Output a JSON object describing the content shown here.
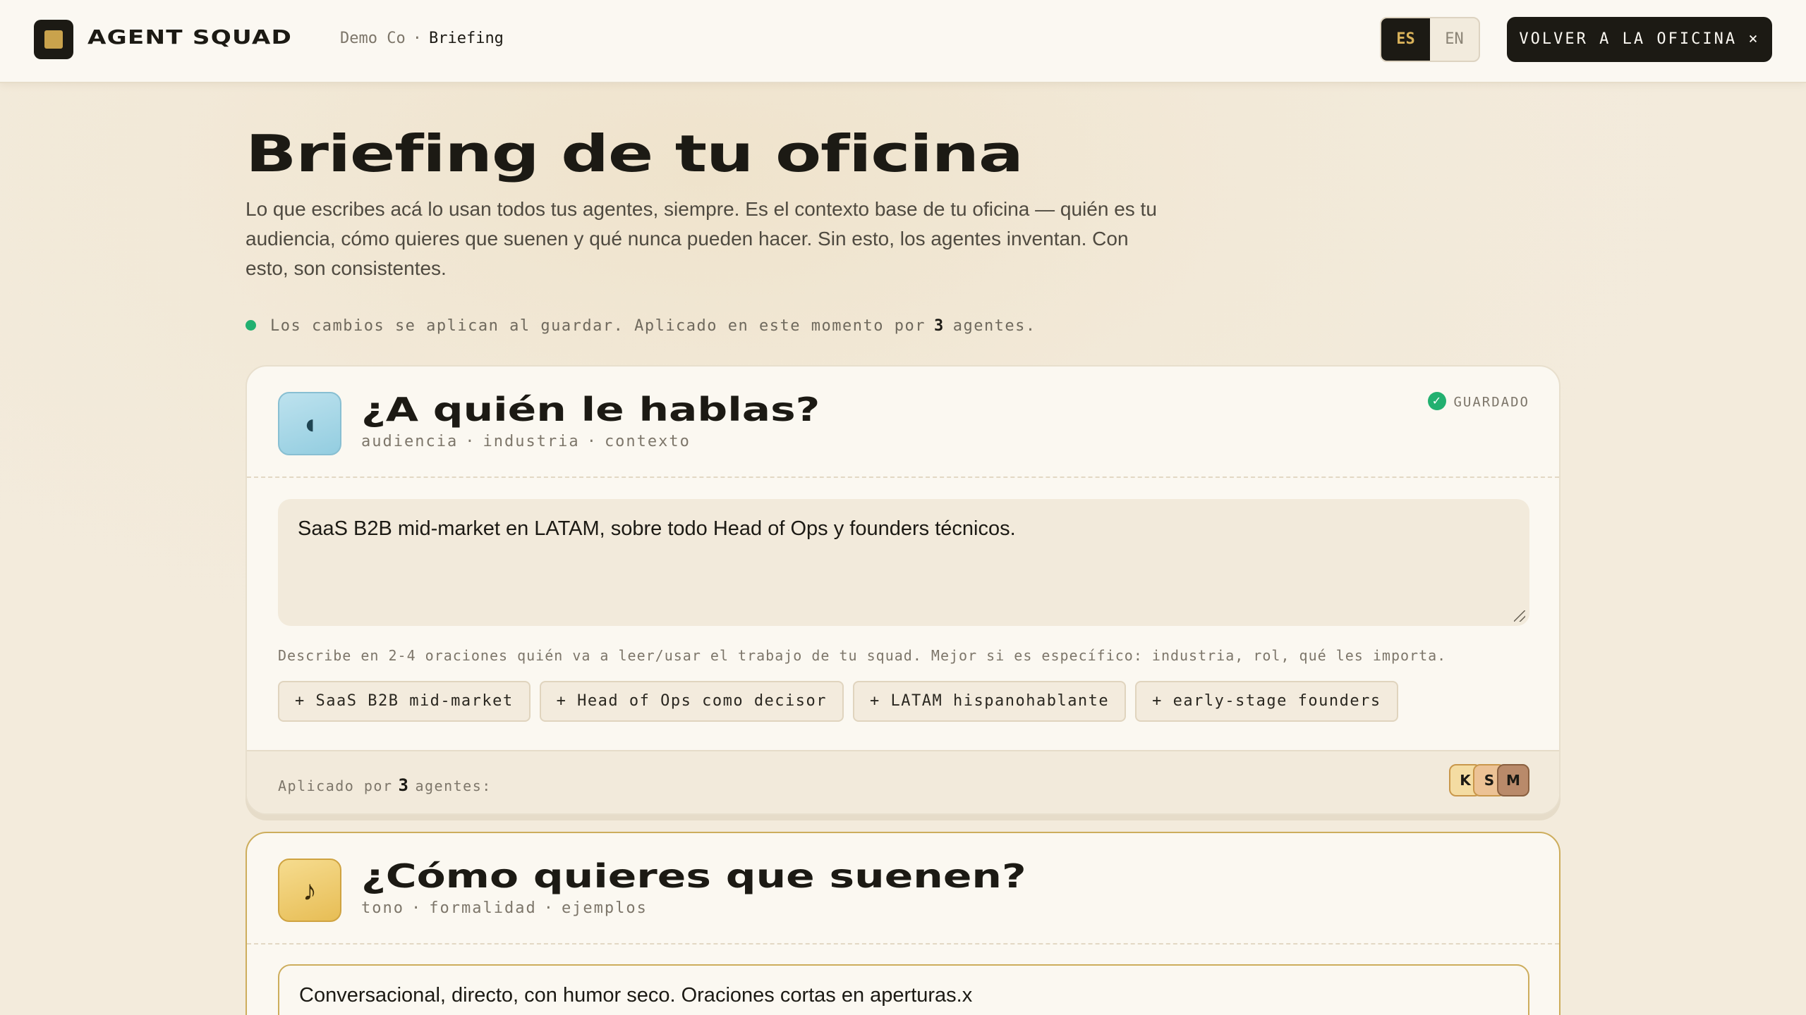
{
  "brand": "AGENT SQUAD",
  "breadcrumb": {
    "company": "Demo Co",
    "separator": "·",
    "current": "Briefing"
  },
  "lang": {
    "es": "ES",
    "en": "EN",
    "selected": "ES"
  },
  "back_button": "VOLVER A LA OFICINA ×",
  "page": {
    "title": "Briefing de tu oficina",
    "intro": "Lo que escribes acá lo usan todos tus agentes, siempre. Es el contexto base de tu oficina — quién es tu audiencia, cómo quieres que suenen y qué nunca pueden hacer. Sin esto, los agentes inventan. Con esto, son consistentes.",
    "status_prefix": "Los cambios se aplican al guardar. Aplicado en este momento por",
    "status_count": "3",
    "status_suffix": "agentes."
  },
  "sections": [
    {
      "icon": "◖",
      "icon_name": "moon-icon",
      "title": "¿A quién le hablas?",
      "tags": [
        "audiencia",
        "industria",
        "contexto"
      ],
      "saved_label": "GUARDADO",
      "value": "SaaS B2B mid-market en LATAM, sobre todo Head of Ops y founders técnicos.",
      "hint": "Describe en 2-4 oraciones quién va a leer/usar el trabajo de tu squad. Mejor si es específico: industria, rol, qué les importa.",
      "suggestions": [
        "+ SaaS B2B mid-market",
        "+ Head of Ops como decisor",
        "+ LATAM hispanohablante",
        "+ early-stage founders"
      ],
      "applied_prefix": "Aplicado por",
      "applied_count": "3",
      "applied_suffix": "agentes:",
      "avatars": [
        "K",
        "S",
        "M"
      ]
    },
    {
      "icon": "♪",
      "icon_name": "music-note-icon",
      "title": "¿Cómo quieres que suenen?",
      "tags": [
        "tono",
        "formalidad",
        "ejemplos"
      ],
      "value": "Conversacional, directo, con humor seco. Oraciones cortas en aperturas.x"
    }
  ],
  "colors": {
    "accent_gold": "#c9a24c",
    "dark": "#1c1a14",
    "saved_green": "#22b070"
  }
}
